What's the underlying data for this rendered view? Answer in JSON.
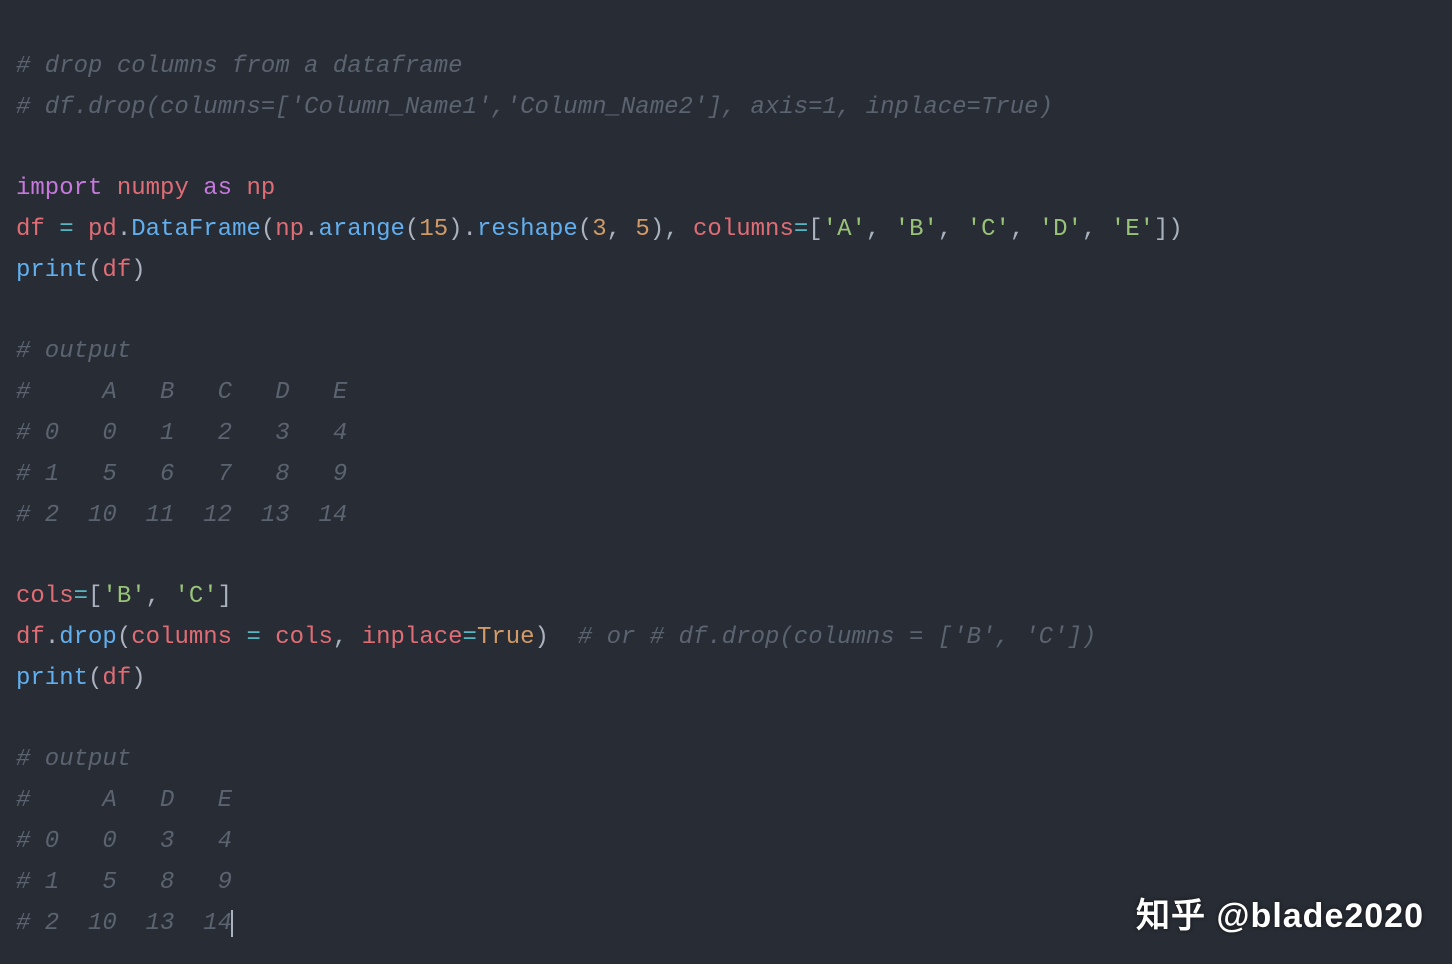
{
  "lines": {
    "c1": "# drop columns from a dataframe",
    "c2": "# df.drop(columns=['Column_Name1','Column_Name2'], axis=1, inplace=True)",
    "c3": "# output",
    "c4": "#     A   B   C   D   E",
    "c5": "# 0   0   1   2   3   4",
    "c6": "# 1   5   6   7   8   9",
    "c7": "# 2  10  11  12  13  14",
    "c8": "  # or # df.drop(columns = ['B', 'C'])",
    "c9": "# output",
    "c10": "#     A   D   E",
    "c11": "# 0   0   3   4",
    "c12": "# 1   5   8   9",
    "c13": "# 2  10  13  14"
  },
  "kw": {
    "import": "import",
    "as": "as"
  },
  "id": {
    "numpy": "numpy",
    "np": "np",
    "df": "df",
    "pd": "pd",
    "columns": "columns",
    "inplace": "inplace",
    "cols": "cols"
  },
  "fn": {
    "DataFrame": "DataFrame",
    "arange": "arange",
    "reshape": "reshape",
    "print": "print",
    "drop": "drop"
  },
  "op": {
    "eq": "=",
    "dot": ".",
    "lp": "(",
    "rp": ")",
    "lb": "[",
    "rb": "]",
    "comma": ", "
  },
  "nu": {
    "n15": "15",
    "n3": "3",
    "n5": "5"
  },
  "st": {
    "A": "'A'",
    "B": "'B'",
    "C": "'C'",
    "D": "'D'",
    "E": "'E'"
  },
  "kc": {
    "True": "True"
  },
  "watermark": "知乎 @blade2020"
}
